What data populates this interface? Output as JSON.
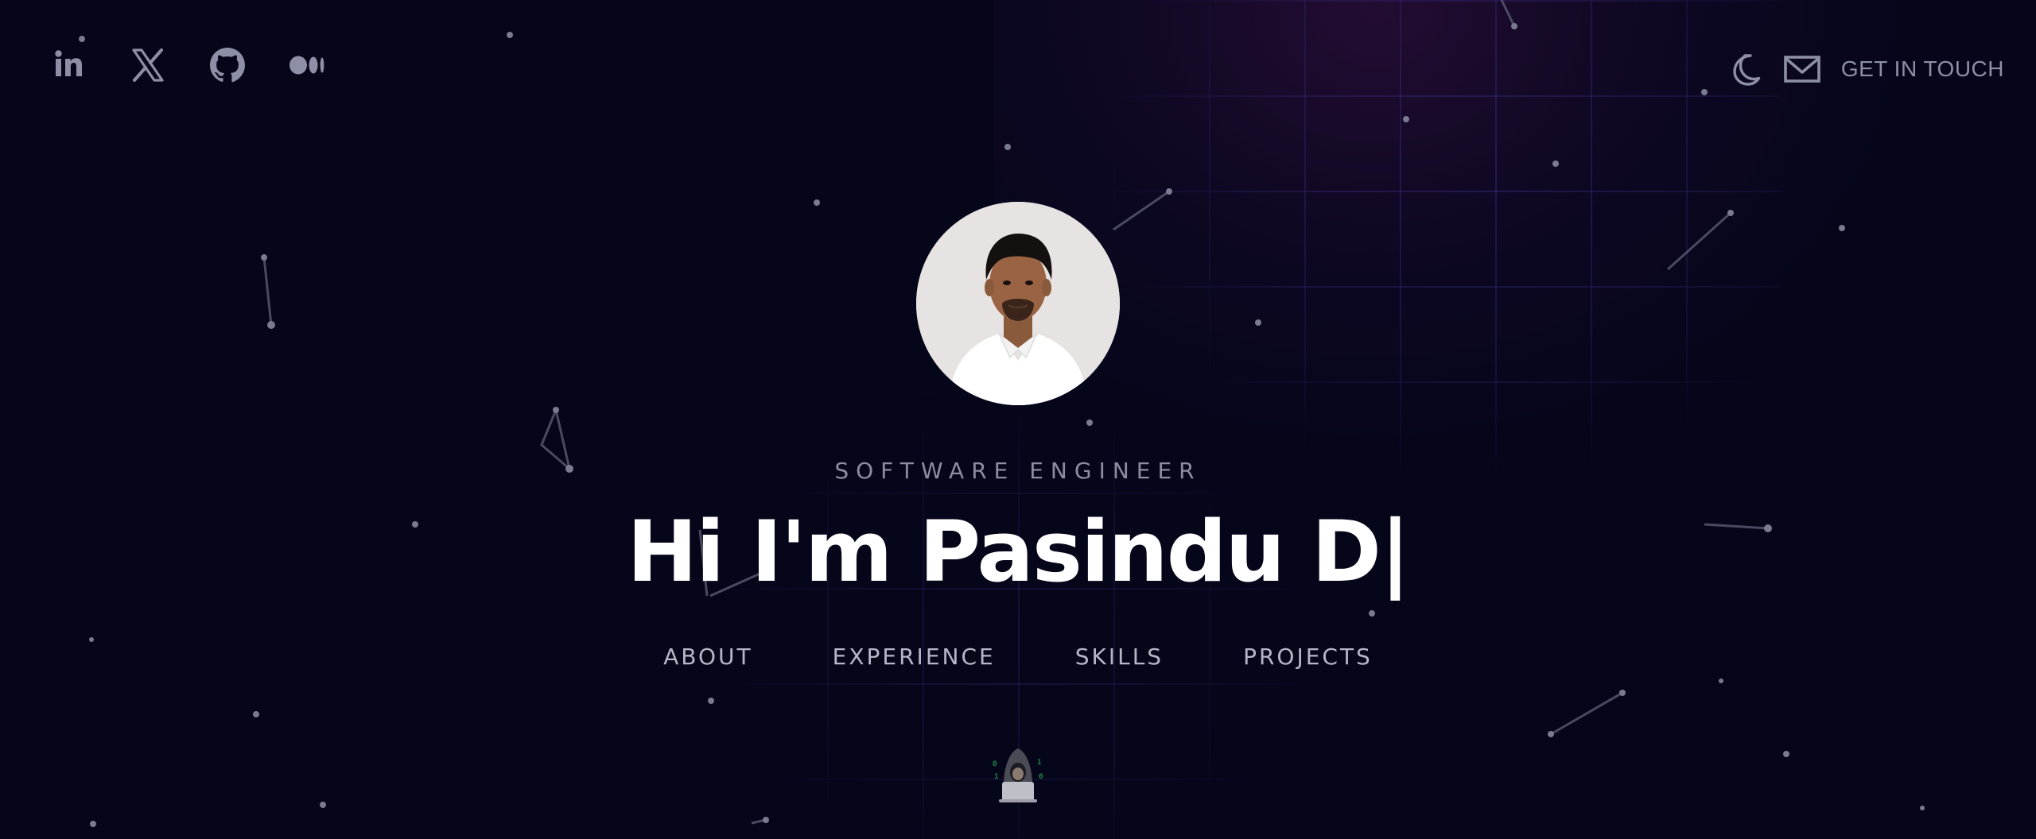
{
  "social": [
    {
      "name": "LinkedIn",
      "icon": "linkedin-icon"
    },
    {
      "name": "X",
      "icon": "x-icon"
    },
    {
      "name": "GitHub",
      "icon": "github-icon"
    },
    {
      "name": "Medium",
      "icon": "medium-icon"
    }
  ],
  "header": {
    "theme_icon": "moon-icon",
    "mail_icon": "mail-icon",
    "contact_label": "GET IN TOUCH"
  },
  "hero": {
    "subtitle": "SOFTWARE ENGINEER",
    "headline": "Hi I'm Pasindu D|"
  },
  "nav": {
    "items": [
      "ABOUT",
      "EXPERIENCE",
      "SKILLS",
      "PROJECTS"
    ]
  },
  "colors": {
    "background": "#05061a",
    "muted_icon": "#8d8fa6",
    "nav_text": "#b5b6c6",
    "headline": "#ffffff"
  }
}
